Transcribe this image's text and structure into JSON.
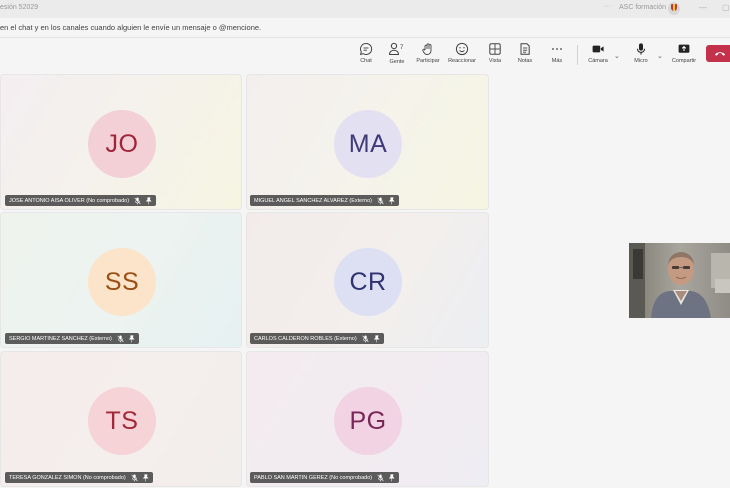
{
  "titlebar": {
    "title": "esión 52029",
    "dots": "···",
    "org_name": "ASC formación",
    "org_avatar_icon": "shield-crest-icon",
    "minimize_glyph": "—",
    "maximize_glyph": "▢"
  },
  "banner": {
    "text": "en el chat y en los canales cuando alguien le envíe un mensaje o @mencione."
  },
  "toolbar": {
    "chat": "Chat",
    "people": "Gente",
    "people_count": "7",
    "raise": "Participar",
    "react": "Reaccionar",
    "view": "Vista",
    "notes": "Notas",
    "more": "Más",
    "camera": "Cámara",
    "mic": "Micro",
    "share": "Compartir",
    "chevron": "⌄",
    "leave_icon": "hang-up-icon"
  },
  "participants": [
    {
      "initials": "JO",
      "name": "JOSE ANTONIO AISA OLIVER (No comprobado)",
      "avatar_bg": "#f3cfd6",
      "initials_color": "#a0243a"
    },
    {
      "initials": "MA",
      "name": "MIGUEL ANGEL SANCHEZ ALVAREZ (Externo)",
      "avatar_bg": "#e3e0f2",
      "initials_color": "#3f3a78"
    },
    {
      "initials": "SS",
      "name": "SERGIO MARTINEZ SANCHEZ (Externo)",
      "avatar_bg": "#fbe4c9",
      "initials_color": "#9a4f15"
    },
    {
      "initials": "CR",
      "name": "CARLOS CALDERON ROBLES (Externo)",
      "avatar_bg": "#dddff3",
      "initials_color": "#2f3372"
    },
    {
      "initials": "TS",
      "name": "TERESA GONZALEZ SIMON (No comprobado)",
      "avatar_bg": "#f5d3d6",
      "initials_color": "#a2283b"
    },
    {
      "initials": "PG",
      "name": "PABLO SAN MARTIN GEREZ (No comprobado)",
      "avatar_bg": "#f1d3e4",
      "initials_color": "#7b2557"
    }
  ],
  "colors": {
    "leave_button": "#c4314b",
    "nametag_bg": "#424242"
  }
}
